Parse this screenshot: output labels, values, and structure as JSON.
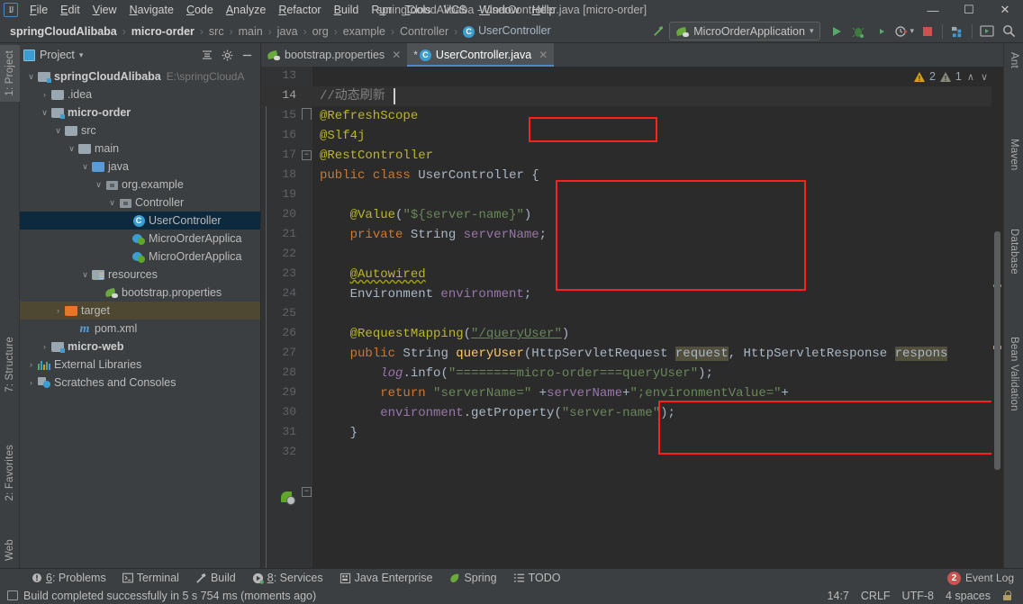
{
  "window": {
    "title": "springCloudAlibaba - UserController.java [micro-order]",
    "minimize": "—",
    "maximize": "☐",
    "close": "✕"
  },
  "menu": [
    {
      "label": "File",
      "mnemonic": "F"
    },
    {
      "label": "Edit",
      "mnemonic": "E"
    },
    {
      "label": "View",
      "mnemonic": "V"
    },
    {
      "label": "Navigate",
      "mnemonic": "N"
    },
    {
      "label": "Code",
      "mnemonic": "C"
    },
    {
      "label": "Analyze",
      "mnemonic": "A"
    },
    {
      "label": "Refactor",
      "mnemonic": "R"
    },
    {
      "label": "Build",
      "mnemonic": "B"
    },
    {
      "label": "Run",
      "mnemonic": "u"
    },
    {
      "label": "Tools",
      "mnemonic": "T"
    },
    {
      "label": "VCS",
      "mnemonic": ""
    },
    {
      "label": "Window",
      "mnemonic": "W"
    },
    {
      "label": "Help",
      "mnemonic": "H"
    }
  ],
  "breadcrumb": {
    "items": [
      {
        "label": "springCloudAlibaba",
        "style": "bold"
      },
      {
        "label": "micro-order",
        "style": "bold"
      },
      {
        "label": "src",
        "style": "dim"
      },
      {
        "label": "main",
        "style": "dim"
      },
      {
        "label": "java",
        "style": "dim"
      },
      {
        "label": "org",
        "style": "dim"
      },
      {
        "label": "example",
        "style": "dim"
      },
      {
        "label": "Controller",
        "style": "dim"
      },
      {
        "label": "UserController",
        "style": "class"
      }
    ],
    "separator": "›"
  },
  "toolbar": {
    "run_config": "MicroOrderApplication",
    "dropdown_caret": "▾",
    "icons": {
      "build": "hammer-icon",
      "run": "run-icon",
      "debug": "debug-icon",
      "run_coverage": "run-with-coverage-icon",
      "profiler": "profiler-icon",
      "stop": "stop-icon",
      "project_structure": "project-structure-icon",
      "update": "update-icon",
      "search": "search-everywhere-icon"
    }
  },
  "left_stripe": [
    {
      "label": "1: Project",
      "active": true
    },
    {
      "label": "7: Structure",
      "active": false
    },
    {
      "label": "2: Favorites",
      "active": false
    },
    {
      "label": "Web",
      "active": false
    }
  ],
  "right_stripe": [
    {
      "label": "Ant"
    },
    {
      "label": "Maven"
    },
    {
      "label": "Database"
    },
    {
      "label": "Bean Validation"
    }
  ],
  "project_panel": {
    "title": "Project",
    "dropdown_caret": "▾",
    "tree": [
      {
        "indent": 0,
        "twist": "∨",
        "icon": "module-folder",
        "label": "springCloudAlibaba",
        "bold": true,
        "path": "E:\\springCloudA",
        "state": "normal"
      },
      {
        "indent": 1,
        "twist": "›",
        "icon": "folder",
        "label": ".idea",
        "bold": false,
        "path": "",
        "state": "normal"
      },
      {
        "indent": 1,
        "twist": "∨",
        "icon": "module-folder",
        "label": "micro-order",
        "bold": true,
        "path": "",
        "state": "normal"
      },
      {
        "indent": 2,
        "twist": "∨",
        "icon": "folder",
        "label": "src",
        "bold": false,
        "path": "",
        "state": "normal"
      },
      {
        "indent": 3,
        "twist": "∨",
        "icon": "folder",
        "label": "main",
        "bold": false,
        "path": "",
        "state": "normal"
      },
      {
        "indent": 4,
        "twist": "∨",
        "icon": "source-folder",
        "label": "java",
        "bold": false,
        "path": "",
        "state": "normal"
      },
      {
        "indent": 5,
        "twist": "∨",
        "icon": "package",
        "label": "org.example",
        "bold": false,
        "path": "",
        "state": "normal"
      },
      {
        "indent": 6,
        "twist": "∨",
        "icon": "package",
        "label": "Controller",
        "bold": false,
        "path": "",
        "state": "normal"
      },
      {
        "indent": 7,
        "twist": "",
        "icon": "class",
        "label": "UserController",
        "bold": false,
        "path": "",
        "state": "selected"
      },
      {
        "indent": 7,
        "twist": "",
        "icon": "runnable-class",
        "label": "MicroOrderApplica",
        "bold": false,
        "path": "",
        "state": "normal"
      },
      {
        "indent": 7,
        "twist": "",
        "icon": "runnable-class",
        "label": "MicroOrderApplica",
        "bold": false,
        "path": "",
        "state": "normal"
      },
      {
        "indent": 4,
        "twist": "∨",
        "icon": "resources-folder",
        "label": "resources",
        "bold": false,
        "path": "",
        "state": "normal"
      },
      {
        "indent": 5,
        "twist": "",
        "icon": "spring-properties",
        "label": "bootstrap.properties",
        "bold": false,
        "path": "",
        "state": "normal"
      },
      {
        "indent": 2,
        "twist": "›",
        "icon": "target-folder",
        "label": "target",
        "bold": false,
        "path": "",
        "state": "highlight"
      },
      {
        "indent": 3,
        "twist": "",
        "icon": "maven",
        "label": "pom.xml",
        "bold": false,
        "path": "",
        "state": "normal"
      },
      {
        "indent": 1,
        "twist": "›",
        "icon": "module-folder",
        "label": "micro-web",
        "bold": true,
        "path": "",
        "state": "normal"
      },
      {
        "indent": 0,
        "twist": "›",
        "icon": "libraries",
        "label": "External Libraries",
        "bold": false,
        "path": "",
        "state": "normal"
      },
      {
        "indent": 0,
        "twist": "›",
        "icon": "scratches",
        "label": "Scratches and Consoles",
        "bold": false,
        "path": "",
        "state": "normal"
      }
    ]
  },
  "editor": {
    "tabs": [
      {
        "label": "bootstrap.properties",
        "icon": "spring-properties-icon",
        "active": false,
        "modified": false,
        "close": "✕"
      },
      {
        "label": "UserController.java",
        "icon": "class-icon",
        "active": true,
        "modified": true,
        "modified_marker": "*",
        "close": "✕"
      }
    ],
    "inspections": {
      "warning_count": "2",
      "weak_warning_count": "1",
      "warning_glyph": "!",
      "up_arrow": "∧",
      "down_arrow": "∨"
    },
    "first_line": 13,
    "current_line": 14,
    "lines": [
      {
        "n": 13,
        "text": ""
      },
      {
        "n": 14,
        "text": "//动态刷新"
      },
      {
        "n": 15,
        "text": "@RefreshScope"
      },
      {
        "n": 16,
        "text": "@Slf4j"
      },
      {
        "n": 17,
        "text": "@RestController"
      },
      {
        "n": 18,
        "text": "public class UserController {"
      },
      {
        "n": 19,
        "text": ""
      },
      {
        "n": 20,
        "text": "    @Value(\"${server-name}\")"
      },
      {
        "n": 21,
        "text": "    private String serverName;"
      },
      {
        "n": 22,
        "text": ""
      },
      {
        "n": 23,
        "text": "    @Autowired"
      },
      {
        "n": 24,
        "text": "    Environment environment;"
      },
      {
        "n": 25,
        "text": ""
      },
      {
        "n": 26,
        "text": "    @RequestMapping(\"/queryUser\")"
      },
      {
        "n": 27,
        "text": "    public String queryUser(HttpServletRequest request, HttpServletResponse response"
      },
      {
        "n": 28,
        "text": "        log.info(\"========micro-order===queryUser\");"
      },
      {
        "n": 29,
        "text": "        return \"serverName=\" +serverName+\";environmentValue=\"+"
      },
      {
        "n": 30,
        "text": "        environment.getProperty(\"server-name\");"
      },
      {
        "n": 31,
        "text": "    }"
      },
      {
        "n": 32,
        "text": ""
      }
    ]
  },
  "bottom_tabs": [
    {
      "label": "6: Problems",
      "mnemonic": "6",
      "icon": "problems-icon"
    },
    {
      "label": "Terminal",
      "mnemonic": "",
      "icon": "terminal-icon"
    },
    {
      "label": "Build",
      "mnemonic": "",
      "icon": "build-hammer-icon"
    },
    {
      "label": "8: Services",
      "mnemonic": "8",
      "icon": "services-icon"
    },
    {
      "label": "Java Enterprise",
      "mnemonic": "",
      "icon": "java-enterprise-icon"
    },
    {
      "label": "Spring",
      "mnemonic": "",
      "icon": "spring-leaf-icon"
    },
    {
      "label": "TODO",
      "mnemonic": "",
      "icon": "todo-icon"
    }
  ],
  "event_log": {
    "label": "Event Log",
    "badge": "2"
  },
  "status_bar": {
    "message": "Build completed successfully in 5 s 754 ms (moments ago)",
    "caret_position": "14:7",
    "line_separator": "CRLF",
    "encoding": "UTF-8",
    "indent": "4 spaces",
    "lock_icon": "unlocked-icon"
  },
  "colors": {
    "accent": "#4a88c7",
    "annotation": "#bbb529",
    "keyword": "#cc7832",
    "string": "#6a8759",
    "field": "#9876aa",
    "comment": "#808080",
    "redbox": "#ff2020",
    "selection": "#0d293e",
    "highlight": "#52503c",
    "badge": "#c75450"
  }
}
